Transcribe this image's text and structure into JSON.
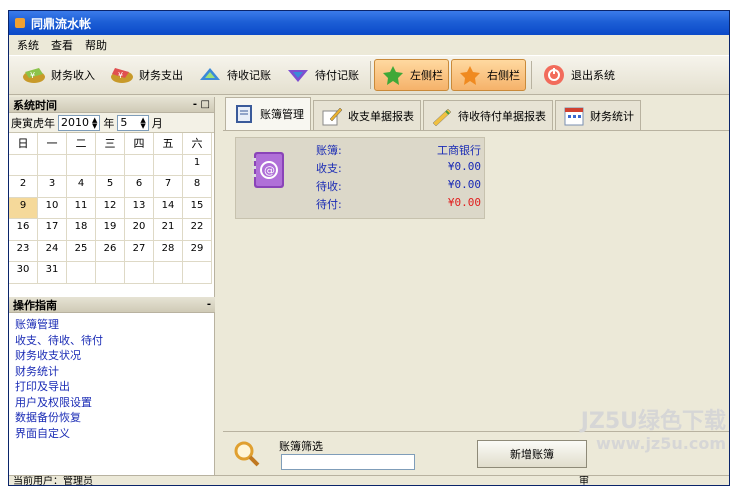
{
  "window": {
    "title": "同鼎流水帐"
  },
  "menu": [
    "系统",
    "查看",
    "帮助"
  ],
  "toolbar": {
    "income": "财务收入",
    "expense": "财务支出",
    "receivable": "待收记账",
    "payable": "待付记账",
    "left_panel": "左侧栏",
    "right_panel": "右侧栏",
    "exit": "退出系统"
  },
  "calendar": {
    "title": "系统时间",
    "ctrls": "- □",
    "lunar_year": "庚寅虎年",
    "year": "2010",
    "year_unit": "年",
    "month": "5",
    "month_unit": "月",
    "weekdays": [
      "日",
      "一",
      "二",
      "三",
      "四",
      "五",
      "六"
    ],
    "today": "9"
  },
  "guide": {
    "title": "操作指南",
    "collapse": "-",
    "items": [
      "账簿管理",
      "收支、待收、待付",
      "财务收支状况",
      "财务统计",
      "打印及导出",
      "用户及权限设置",
      "数据备份恢复",
      "界面自定义"
    ]
  },
  "tabs": [
    "账簿管理",
    "收支单据报表",
    "待收待付单据报表",
    "财务统计"
  ],
  "account": {
    "book_label": "账簿:",
    "book_value": "工商银行",
    "income_label": "收支:",
    "income_value": "¥0.00",
    "receivable_label": "待收:",
    "receivable_value": "¥0.00",
    "payable_label": "待付:",
    "payable_value": "¥0.00"
  },
  "filter": {
    "label": "账簿筛选",
    "new_button": "新增账簿"
  },
  "status": {
    "user": "当前用户：管理员",
    "right": "审"
  },
  "watermark": {
    "line1": "JZ5U绿色下载",
    "line2": "www.jz5u.com"
  }
}
